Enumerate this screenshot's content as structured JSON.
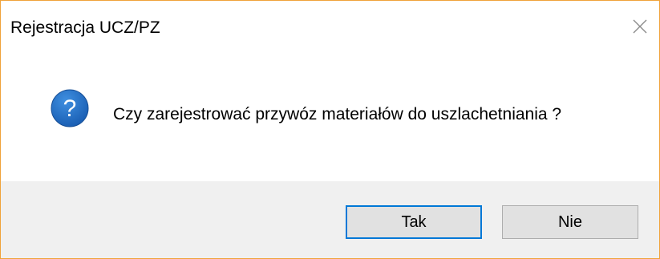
{
  "window": {
    "title": "Rejestracja UCZ/PZ",
    "close_icon": "close-icon",
    "border_color": "#f0a33a"
  },
  "content": {
    "icon": "question-icon",
    "icon_color": "#1e6ec8",
    "message": "Czy zarejestrować przywóz materiałów do uszlachetniania ?"
  },
  "buttons": {
    "yes_label": "Tak",
    "no_label": "Nie",
    "default_border_color": "#0078d7"
  }
}
